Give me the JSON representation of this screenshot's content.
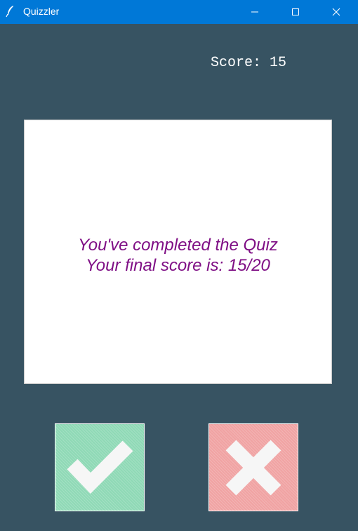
{
  "window": {
    "title": "Quizzler",
    "app_icon": "feather-icon",
    "controls": [
      "minimize-icon",
      "maximize-icon",
      "close-icon"
    ]
  },
  "score": {
    "label": "Score: 15"
  },
  "card": {
    "line1": "You've completed the Quiz",
    "line2": "Your final score is: 15/20"
  },
  "buttons": {
    "true_icon": "checkmark-icon",
    "false_icon": "cross-icon"
  },
  "colors": {
    "background": "#375362",
    "titlebar": "#0078d7",
    "question_text": "#7f0f85",
    "true_button": "#8fd9b6",
    "false_button": "#f0a3a3"
  }
}
